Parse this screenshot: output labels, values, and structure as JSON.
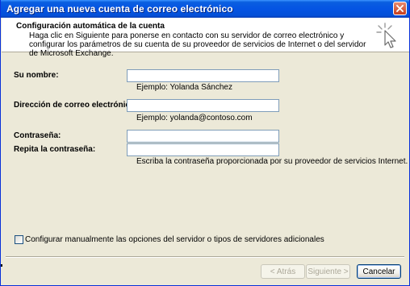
{
  "window": {
    "title": "Agregar una nueva cuenta de correo electrónico",
    "close_icon": "close-icon"
  },
  "header": {
    "title": "Configuración automática de la cuenta",
    "description": "Haga clic en Siguiente para ponerse en contacto con su servidor de correo electrónico y configurar los parámetros de su cuenta de su proveedor de servicios de Internet o del servidor de Microsoft Exchange.",
    "icon": "mouse-cursor-icon"
  },
  "form": {
    "name_label": "Su nombre:",
    "name_value": "",
    "name_hint": "Ejemplo: Yolanda Sánchez",
    "email_label": "Dirección de correo electrónico:",
    "email_value": "",
    "email_hint": "Ejemplo: yolanda@contoso.com",
    "password_label": "Contraseña:",
    "password_value": "",
    "confirm_label": "Repita la contraseña:",
    "confirm_value": "",
    "password_hint": "Escriba la contraseña proporcionada por su proveedor de servicios Internet."
  },
  "manual": {
    "label": "Configurar manualmente las opciones del servidor o tipos de servidores adicionales",
    "checked": false
  },
  "buttons": {
    "back": "< Atrás",
    "next": "Siguiente >",
    "cancel": "Cancelar"
  },
  "colors": {
    "titlebar": "#0554e3",
    "dialog_bg": "#ece9d8",
    "close_button": "#c6401f"
  }
}
